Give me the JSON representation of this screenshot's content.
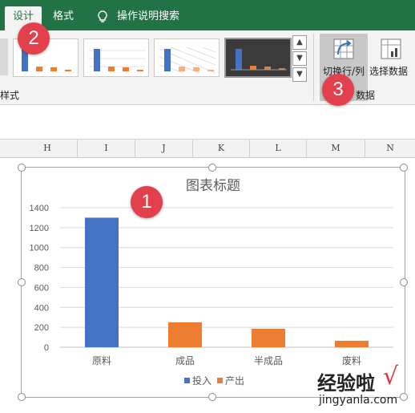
{
  "ribbon_tabs": {
    "design": "设计",
    "format": "格式",
    "tell_me": "操作说明搜索"
  },
  "ribbon": {
    "styles_group_label": "样式",
    "switch_row_col": "切换行/列",
    "select_data": "选择数据",
    "data_group_label": "数据"
  },
  "columns": [
    "H",
    "I",
    "J",
    "K",
    "L",
    "M",
    "N"
  ],
  "badges": {
    "b1": "1",
    "b2": "2",
    "b3": "3"
  },
  "watermark": {
    "text": "经验啦",
    "url": "jingyanla.com",
    "check": "√"
  },
  "colors": {
    "excel_green": "#217346",
    "series_input": "#4472c4",
    "series_output": "#ed7d31",
    "badge": "#e2404c"
  },
  "chart_data": {
    "type": "bar",
    "title": "图表标题",
    "categories": [
      "原料",
      "成品",
      "半成品",
      "废料"
    ],
    "series": [
      {
        "name": "投入",
        "values": [
          1300,
          0,
          0,
          0
        ],
        "color": "#4472c4"
      },
      {
        "name": "产出",
        "values": [
          0,
          250,
          185,
          65
        ],
        "color": "#ed7d31"
      }
    ],
    "ylim": [
      0,
      1400
    ],
    "yticks": [
      0,
      200,
      400,
      600,
      800,
      1000,
      1200,
      1400
    ],
    "grid": true,
    "legend": "bottom"
  }
}
